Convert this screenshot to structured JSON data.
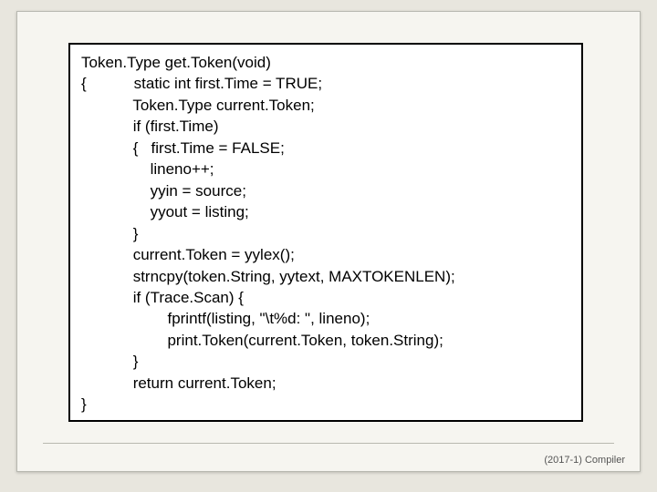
{
  "footer": "(2017-1) Compiler",
  "code": {
    "l1": "Token.Type get.Token(void)",
    "l2a": "{",
    "l2b": "static int first.Time = TRUE;",
    "l3": "Token.Type current.Token;",
    "l4": "if (first.Time)",
    "l5": "{   first.Time = FALSE;",
    "l6": "lineno++;",
    "l7": "yyin = source;",
    "l8": "yyout = listing;",
    "l9": "}",
    "l10": "current.Token = yylex();",
    "l11": "strncpy(token.String, yytext, MAXTOKENLEN);",
    "l12": "if (Trace.Scan) {",
    "l13": "fprintf(listing, \"\\t%d: \", lineno);",
    "l14": "print.Token(current.Token, token.String);",
    "l15": "}",
    "l16": "return current.Token;",
    "l17": "}"
  }
}
